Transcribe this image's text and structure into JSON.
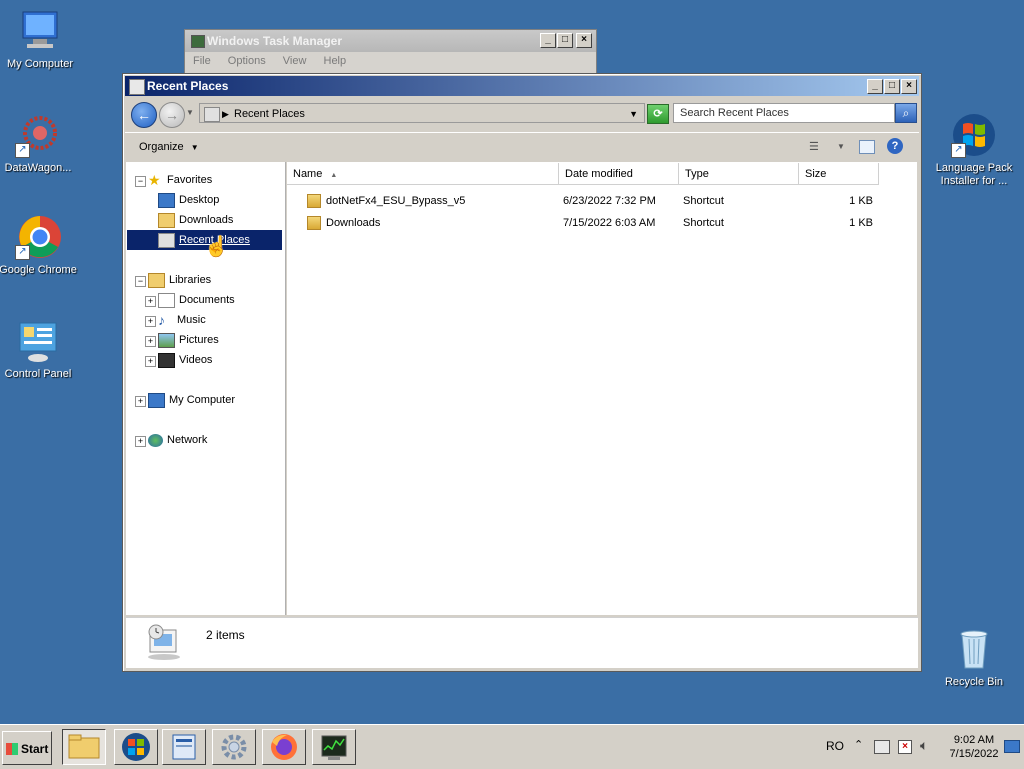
{
  "desktop": {
    "icons": [
      {
        "label": "My Computer"
      },
      {
        "label": "DataWagon..."
      },
      {
        "label": "Google Chrome"
      },
      {
        "label": "Control Panel"
      },
      {
        "label_line1": "Language Pack",
        "label_line2": "Installer for ..."
      },
      {
        "label": "Recycle Bin"
      }
    ]
  },
  "task_manager": {
    "title": "Windows Task Manager",
    "menu": [
      "File",
      "Options",
      "View",
      "Help"
    ]
  },
  "explorer": {
    "title": "Recent Places",
    "address": "Recent Places",
    "search_placeholder": "Search Recent Places",
    "toolbar": {
      "organize": "Organize"
    },
    "nav": {
      "favorites": "Favorites",
      "desktop": "Desktop",
      "downloads": "Downloads",
      "recent_places": "Recent Places",
      "libraries": "Libraries",
      "documents": "Documents",
      "music": "Music",
      "pictures": "Pictures",
      "videos": "Videos",
      "my_computer": "My Computer",
      "network": "Network"
    },
    "columns": [
      "Name",
      "Date modified",
      "Type",
      "Size"
    ],
    "files": [
      {
        "name": "dotNetFx4_ESU_Bypass_v5",
        "date": "6/23/2022 7:32 PM",
        "type": "Shortcut",
        "size": "1 KB"
      },
      {
        "name": "Downloads",
        "date": "7/15/2022 6:03 AM",
        "type": "Shortcut",
        "size": "1 KB"
      }
    ],
    "status": "2 items"
  },
  "taskbar": {
    "start": "Start",
    "language": "RO",
    "time": "9:02 AM",
    "date": "7/15/2022"
  }
}
